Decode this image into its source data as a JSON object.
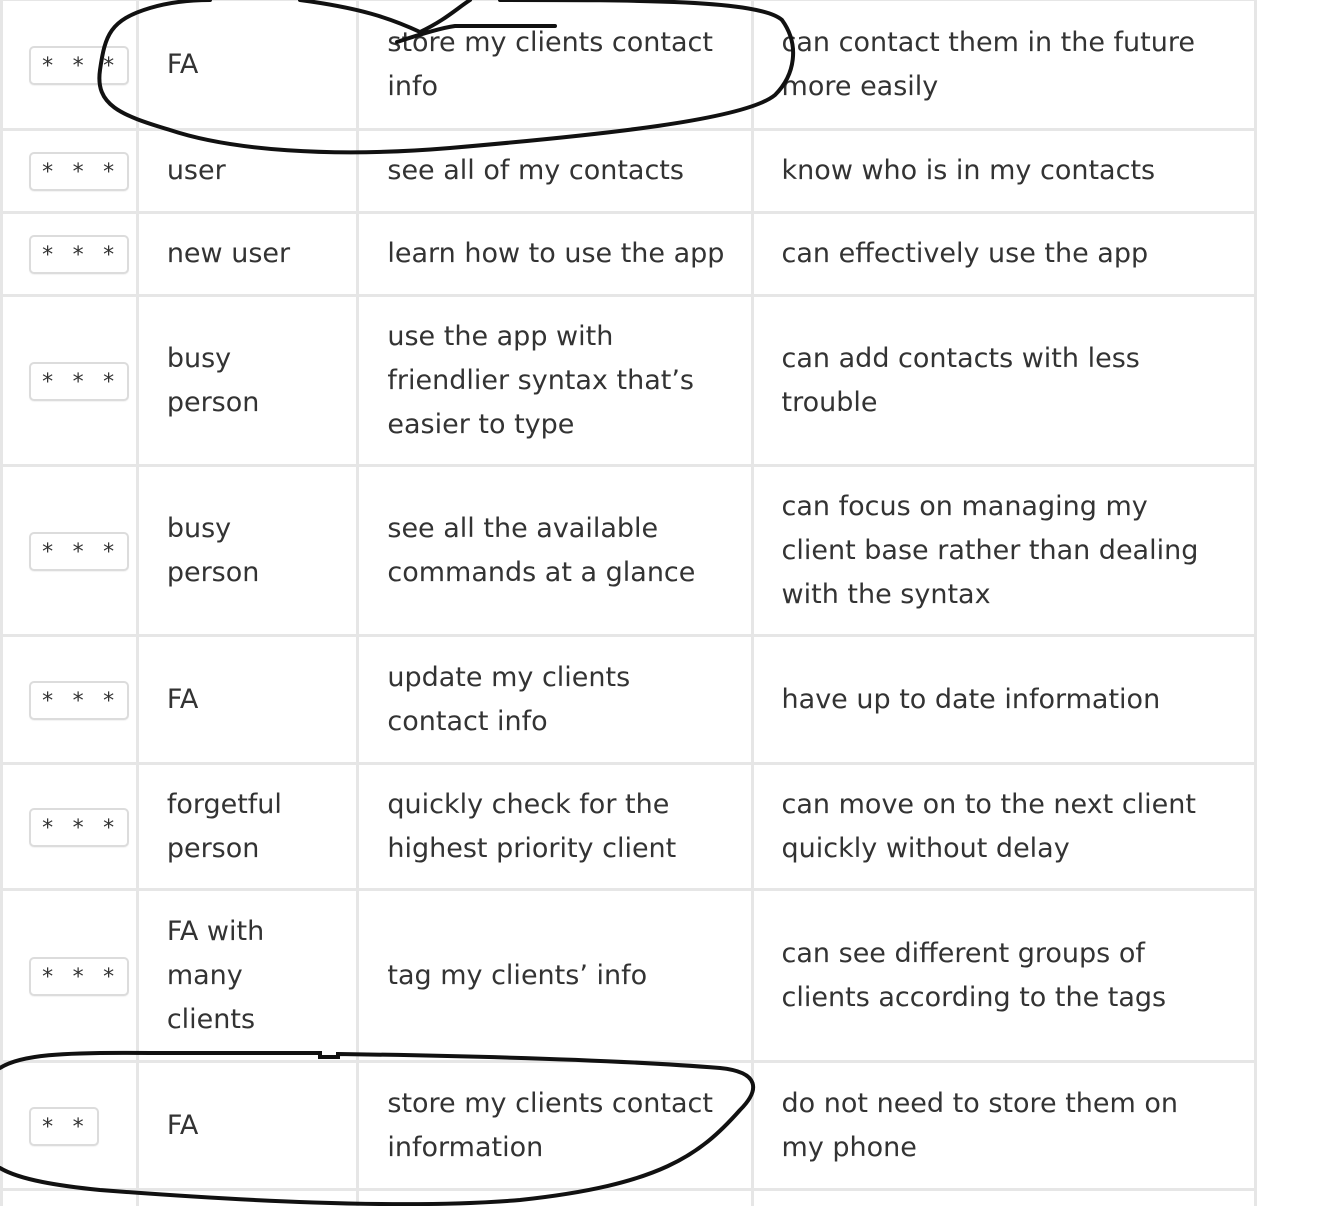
{
  "rows": [
    {
      "priority": "* * *",
      "as_a": "FA",
      "i_want_to": "store my clients contact info",
      "so_that": "can contact them in the future more easily"
    },
    {
      "priority": "* * *",
      "as_a": "user",
      "i_want_to": "see all of my contacts",
      "so_that": "know who is in my contacts"
    },
    {
      "priority": "* * *",
      "as_a": "new user",
      "i_want_to": "learn how to use the app",
      "so_that": "can effectively use the app"
    },
    {
      "priority": "* * *",
      "as_a": "busy person",
      "i_want_to": "use the app with friendlier syntax that’s easier to type",
      "so_that": "can add contacts with less trouble"
    },
    {
      "priority": "* * *",
      "as_a": "busy person",
      "i_want_to": "see all the available commands at a glance",
      "so_that": "can focus on managing my client base rather than dealing with the syntax"
    },
    {
      "priority": "* * *",
      "as_a": "FA",
      "i_want_to": "update my clients contact info",
      "so_that": "have up to date information"
    },
    {
      "priority": "* * *",
      "as_a": "forgetful person",
      "i_want_to": "quickly check for the highest priority client",
      "so_that": "can move on to the next client quickly without delay"
    },
    {
      "priority": "* * *",
      "as_a": "FA with many clients",
      "i_want_to": "tag my clients’ info",
      "so_that": "can see different groups of clients according to the tags"
    },
    {
      "priority": "* *",
      "as_a": "FA",
      "i_want_to": "store my clients contact information",
      "so_that": "do not need to store them on my phone"
    }
  ]
}
